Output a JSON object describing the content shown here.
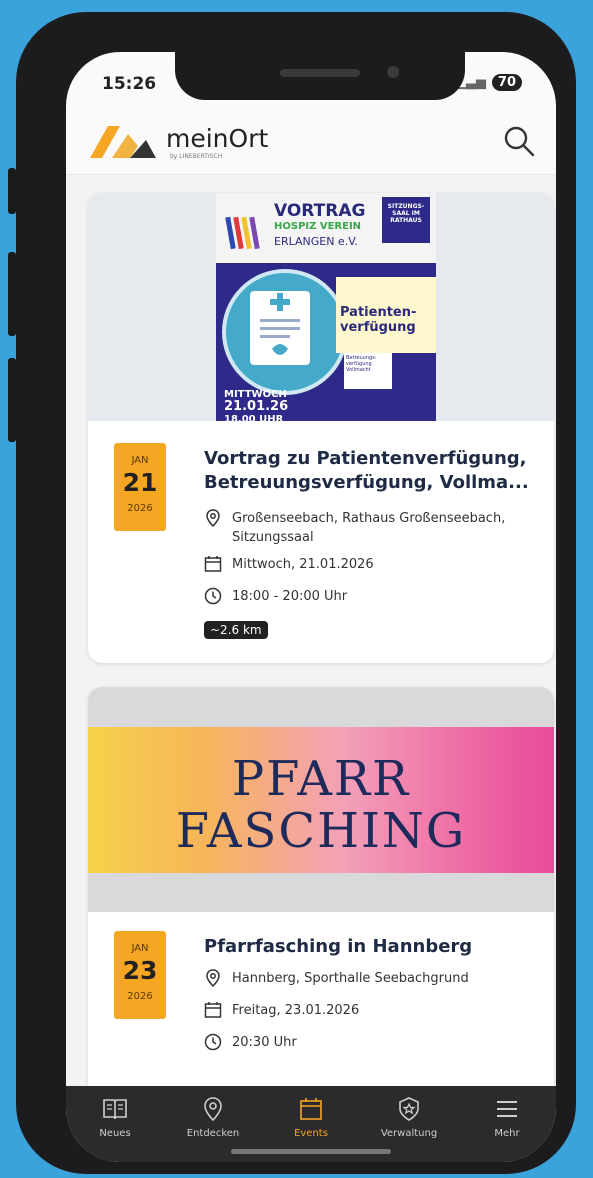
{
  "status": {
    "time": "15:26",
    "battery": "70"
  },
  "header": {
    "brand": "meinOrt",
    "brand_sub": "by LINEBERTISCH"
  },
  "events": [
    {
      "poster": {
        "title": "VORTRAG",
        "line1": "HOSPIZ VEREIN",
        "line2": "ERLANGEN e.V.",
        "place": "SITZUNGS-SAAL IM RATHAUS",
        "topic": "Patienten-verfügung",
        "weekday": "MITTWOCH",
        "date": "21.01.26",
        "time": "18.00 UHR",
        "box": "Betreuungs-verfügung Vollmacht"
      },
      "month": "JAN",
      "day": "21",
      "year": "2026",
      "title_line1": "Vortrag zu Patientenverfügung,",
      "title_line2": "Betreuungsverfügung, Vollma...",
      "location_line1": "Großenseebach, Rathaus Großenseebach,",
      "location_line2": "Sitzungssaal",
      "date_text": "Mittwoch, 21.01.2026",
      "time_text": "18:00 - 20:00 Uhr",
      "distance": "~2.6 km"
    },
    {
      "banner_line1": "PFARR",
      "banner_line2": "FASCHING",
      "month": "JAN",
      "day": "23",
      "year": "2026",
      "title_line1": "Pfarrfasching in Hannberg",
      "location_line1": "Hannberg, Sporthalle Seebachgrund",
      "date_text": "Freitag, 23.01.2026",
      "time_text": "20:30 Uhr"
    }
  ],
  "nav": [
    {
      "label": "Neues",
      "icon": "book-icon"
    },
    {
      "label": "Entdecken",
      "icon": "map-pin-icon"
    },
    {
      "label": "Events",
      "icon": "calendar-icon",
      "active": true
    },
    {
      "label": "Verwaltung",
      "icon": "shield-star-icon"
    },
    {
      "label": "Mehr",
      "icon": "menu-icon"
    }
  ],
  "colors": {
    "accent": "#f5a623",
    "nav_bg": "#2b2b2e",
    "background": "#3ba3dc"
  }
}
